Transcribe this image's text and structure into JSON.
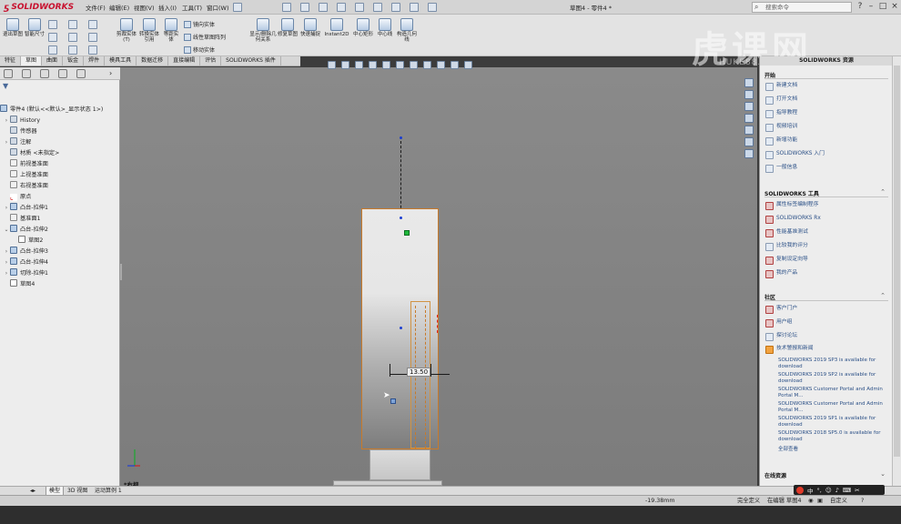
{
  "titlebar": {
    "brand": "SOLIDWORKS",
    "menus": [
      "文件(F)",
      "编辑(E)",
      "视图(V)",
      "插入(I)",
      "工具(T)",
      "窗口(W)"
    ],
    "doc_title": "草图4 - 零件4 *",
    "search_placeholder": "搜索命令",
    "help": "?",
    "min": "–",
    "max": "□",
    "close": "×"
  },
  "ribbon": {
    "buttons": [
      {
        "label": "退出草图"
      },
      {
        "label": "智能尺寸"
      },
      {
        "label": "剪裁实体(T)"
      },
      {
        "label": "转换实体引用"
      },
      {
        "label": "等距实体"
      },
      {
        "label": "显示/删除几何关系"
      },
      {
        "label": "修复草图"
      },
      {
        "label": "快速捕捉"
      },
      {
        "label": "Instant2D"
      },
      {
        "label": "中心矩形"
      },
      {
        "label": "中心线"
      },
      {
        "label": "构造几何线"
      }
    ],
    "small": [
      "镜向实体",
      "线性草图阵列",
      "移动实体"
    ]
  },
  "tabs": [
    "特征",
    "草图",
    "曲面",
    "钣金",
    "焊件",
    "模具工具",
    "数据迁移",
    "直接编辑",
    "评估",
    "SOLIDWORKS 插件"
  ],
  "tree": {
    "root": "零件4 (默认<<默认>_显示状态 1>)",
    "items": [
      {
        "label": "History"
      },
      {
        "label": "传感器"
      },
      {
        "label": "注解"
      },
      {
        "label": "材质 <未指定>"
      },
      {
        "label": "前视基准面"
      },
      {
        "label": "上视基准面"
      },
      {
        "label": "右视基准面"
      },
      {
        "label": "原点"
      },
      {
        "label": "凸台-拉伸1"
      },
      {
        "label": "基准面1"
      },
      {
        "label": "凸台-拉伸2"
      },
      {
        "label": "草图2"
      },
      {
        "label": "凸台-拉伸3"
      },
      {
        "label": "凸台-拉伸4"
      },
      {
        "label": "切除-拉伸1"
      },
      {
        "label": "草图4"
      }
    ]
  },
  "viewport": {
    "dimension": "13.50",
    "view_name": "*右视"
  },
  "taskpane": {
    "title": "SOLIDWORKS 资源",
    "sections": {
      "start": {
        "label": "开始",
        "items": [
          "新建文档",
          "打开文档",
          "指导教程",
          "视频培训",
          "新增功能",
          "SOLIDWORKS 入门",
          "一般信息"
        ]
      },
      "tools": {
        "label": "SOLIDWORKS 工具",
        "items": [
          "属性标签编制程序",
          "SOLIDWORKS Rx",
          "性能基准测试",
          "比较我的评分",
          "复制设定向导",
          "我的产品"
        ]
      },
      "community": {
        "label": "社区",
        "items": [
          "客户门户",
          "用户组",
          "探讨论坛",
          "技术警报和新闻"
        ],
        "news": [
          "SOLIDWORKS 2019 SP3 is available for download",
          "SOLIDWORKS 2019 SP2 is available for download",
          "SOLIDWORKS Customer Portal and Admin Portal M...",
          "SOLIDWORKS Customer Portal and Admin Portal M...",
          "SOLIDWORKS 2019 SP1 is available for download",
          "SOLIDWORKS 2018 SP5.0 is available for download"
        ],
        "more": "全部查看"
      },
      "online": {
        "label": "在线资源"
      }
    }
  },
  "bottom_tabs": [
    "模型",
    "3D 视图",
    "运动算例 1"
  ],
  "status": {
    "coord": "-19.38mm",
    "state": "完全定义",
    "editing": "在编辑 草图4",
    "custom": "自定义"
  },
  "ime": {
    "text": "中"
  },
  "watermark": {
    "text": "虎课网",
    "sub": "HUKE88.COM"
  }
}
